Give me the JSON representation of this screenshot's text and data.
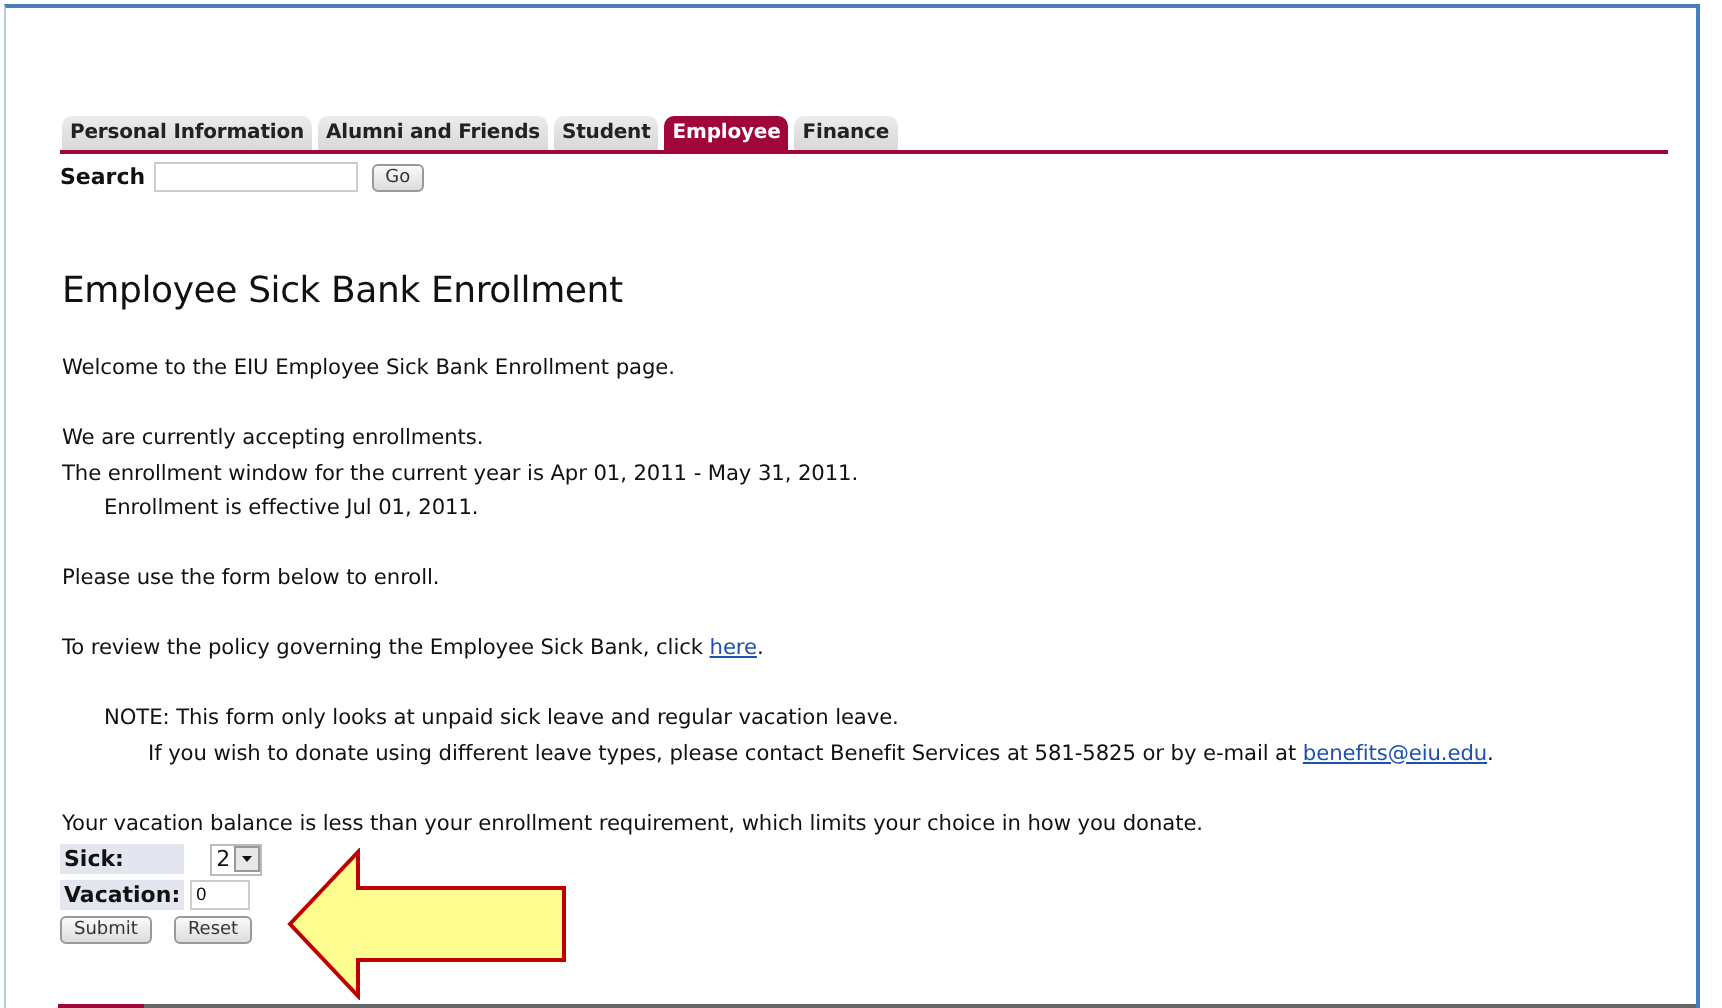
{
  "tabs": [
    {
      "label": "Personal Information",
      "selected": false
    },
    {
      "label": "Alumni and Friends",
      "selected": false
    },
    {
      "label": "Student",
      "selected": false
    },
    {
      "label": "Employee",
      "selected": true
    },
    {
      "label": "Finance",
      "selected": false
    }
  ],
  "search": {
    "label": "Search",
    "button": "Go"
  },
  "heading": "Employee Sick Bank Enrollment",
  "paragraphs": [
    {
      "lines": [
        {
          "kind": "plain",
          "text": "Welcome to the EIU Employee Sick Bank Enrollment page."
        }
      ]
    },
    {
      "lines": [
        {
          "kind": "plain",
          "text": "We are currently accepting enrollments."
        },
        {
          "kind": "plain",
          "text": "The enrollment window for the current year is Apr 01, 2011 - May 31, 2011."
        },
        {
          "kind": "indented",
          "text": "Enrollment is effective Jul 01, 2011."
        }
      ]
    },
    {
      "lines": [
        {
          "kind": "plain",
          "text": "Please use the form below to enroll."
        }
      ]
    },
    {
      "lines": [
        {
          "kind": "plain",
          "text": "To review the policy governing the Employee Sick Bank, click ",
          "link": "here",
          "after": "."
        }
      ]
    },
    {
      "lines": [
        {
          "kind": "indented",
          "text": "NOTE: This form only looks at unpaid sick leave and regular vacation leave."
        },
        {
          "kind": "double-indented",
          "text": "If you wish to donate using different leave types, please contact Benefit Services at 581-5825 or by e-mail at ",
          "link": "benefits@eiu.edu",
          "after": "."
        }
      ]
    },
    {
      "lines": [
        {
          "kind": "plain",
          "text": "Your vacation balance is less than your enrollment requirement, which limits your choice in how you donate."
        }
      ]
    }
  ],
  "form": {
    "sick": {
      "label": "Sick:",
      "value": "2"
    },
    "vacation": {
      "label": "Vacation:",
      "value": "0"
    },
    "buttons": [
      "Submit",
      "Reset"
    ]
  }
}
